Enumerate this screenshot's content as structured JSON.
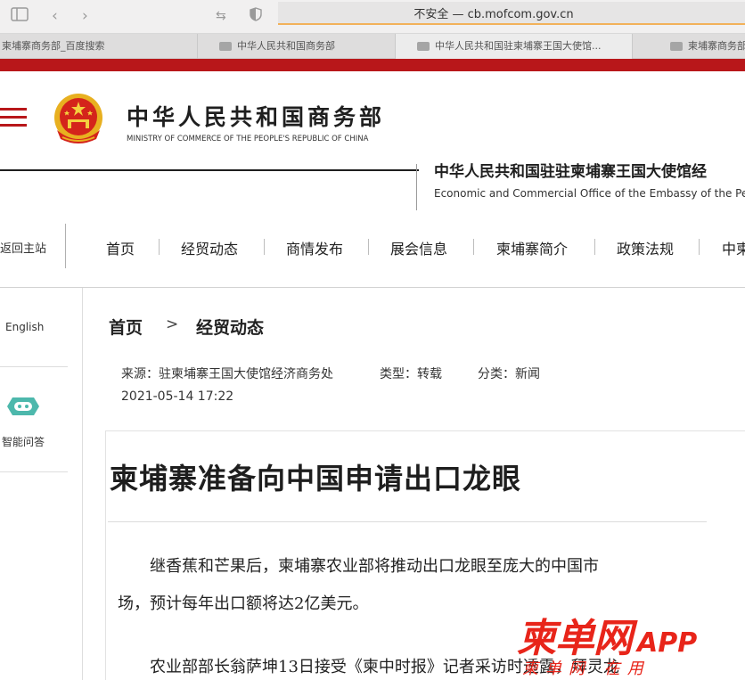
{
  "browser": {
    "url_text": "不安全 — cb.mofcom.gov.cn",
    "tabs": [
      {
        "label": "柬埔寨商务部_百度搜索"
      },
      {
        "label": "中华人民共和国商务部"
      },
      {
        "label": "中华人民共和国驻柬埔寨王国大使馆..."
      },
      {
        "label": "柬埔寨商务部"
      }
    ]
  },
  "header": {
    "title": "中华人民共和国商务部",
    "subtitle": "MINISTRY OF COMMERCE OF THE PEOPLE'S REPUBLIC OF CHINA",
    "embassy_title": "中华人民共和国驻驻柬埔寨王国大使馆经",
    "embassy_subtitle": "Economic and Commercial Office of the Embassy of the People"
  },
  "nav": {
    "back_label": "返回主站",
    "items": [
      "首页",
      "经贸动态",
      "商情发布",
      "展会信息",
      "柬埔寨简介",
      "政策法规",
      "中柬"
    ]
  },
  "sidebar": {
    "english_label": "English",
    "ai_label": "智能问答"
  },
  "breadcrumb": {
    "home": "首页",
    "separator": ">",
    "current": "经贸动态"
  },
  "article": {
    "source": "来源：驻柬埔寨王国大使馆经济商务处",
    "type": "类型：转载",
    "category": "分类：新闻",
    "datetime": "2021-05-14 17:22",
    "title": "柬埔寨准备向中国申请出口龙眼",
    "para1_line1": "继香蕉和芒果后，柬埔寨农业部将推动出口龙眼至庞大的中国市",
    "para1_line2": "场，预计每年出口额将达2亿美元。",
    "para2_line1": "农业部部长翁萨坤13日接受《柬中时报》记者采访时透露，拜灵龙"
  },
  "watermark": {
    "main": "柬单网",
    "app": "APP",
    "small": "柬单网 在用"
  },
  "colors": {
    "brand_red": "#b8171a",
    "watermark_red": "#e8251a",
    "robot_teal": "#4db8ac"
  }
}
